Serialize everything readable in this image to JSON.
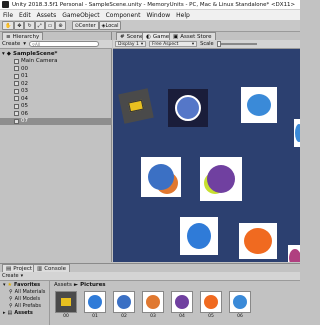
{
  "window": {
    "title": "Unity 2018.3.5f1 Personal - SampleScene.unity - MemoryUnits - PC, Mac & Linux Standalone* <DX11>"
  },
  "menu": [
    "File",
    "Edit",
    "Assets",
    "GameObject",
    "Component",
    "Window",
    "Help"
  ],
  "toolbar": {
    "pivot_center": "Center",
    "pivot_local": "Local"
  },
  "hierarchy": {
    "tab_label": "Hierarchy",
    "create_label": "Create",
    "search_placeholder": "All",
    "scene_name": "SampleScene*",
    "items": [
      "Main Camera",
      "00",
      "01",
      "02",
      "03",
      "04",
      "05",
      "06",
      "07"
    ]
  },
  "scene_view": {
    "tabs": [
      "Scene",
      "Game",
      "Asset Store"
    ],
    "active_tab": "Game",
    "display_label": "Display 1",
    "aspect_label": "Free Aspect",
    "scale_label": "Scale"
  },
  "project": {
    "tabs": [
      "Project",
      "Console"
    ],
    "create_label": "Create",
    "favorites_label": "Favorites",
    "favorites": [
      "All Materials",
      "All Models",
      "All Prefabs"
    ],
    "assets_label": "Assets",
    "breadcrumb": [
      "Assets",
      "Pictures"
    ],
    "thumb_labels": [
      "00",
      "01",
      "02",
      "03",
      "04",
      "05",
      "06"
    ]
  },
  "colors": {
    "game_background": "#2c4070",
    "editor_gray": "#c2c2c2"
  }
}
